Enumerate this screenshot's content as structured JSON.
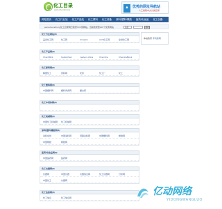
{
  "header": {
    "logo_title": "化工目录",
    "logo_url": "www.chemdir.org",
    "banner_title": "优秀的网址导航站",
    "banner_sub": "人工编辑中文分类目录"
  },
  "nav": {
    "items": [
      "网站首页",
      "化工行业站",
      "化工产品站",
      "化工原料",
      "化工设备",
      "涂料/塑料/橡胶",
      "医药/化妆品",
      "化工仪器"
    ]
  },
  "search": {
    "text": "www.chemdir.org化工目录网已收录XXX家网站，当前收录量100个优秀网站",
    "select_value": "全部",
    "button_label": "搜索"
  },
  "sidebar": {
    "text": "本站收录",
    "link": "手机版网"
  },
  "sections": [
    {
      "title": "化工行业网站(8)",
      "rows": [
        [
          "盖德化工网",
          "化工网",
          "chinaHG",
          "ACS化工网",
          "全球化工网"
        ]
      ]
    },
    {
      "title": "化工产品网(8)",
      "rows": [
        [
          "ChemBlink",
          "GuideChem",
          "made-in-china",
          "Chemrine",
          "ChemicalBook"
        ]
      ]
    },
    {
      "title": "化工原料网(8)",
      "rows": [
        [
          "精细化工",
          "原料网",
          "化原",
          "化工厂",
          "化工"
        ]
      ]
    },
    {
      "title": "化工塑料网(8)",
      "rows": [
        [
          "中国塑料网",
          "塑料商务网",
          "塑交所"
        ]
      ]
    },
    {
      "title": "化工中间体网(8)",
      "rows": [
        []
      ]
    },
    {
      "title": "化工机械网(8)",
      "rows": [
        [
          "中国化工机械网",
          "化工机械网"
        ]
      ]
    },
    {
      "title": "涂料/塑料/橡胶网(8)",
      "rows": [
        [
          "涂料在线",
          "中国涂料网",
          "慧聪涂料网",
          "中国塑料网",
          "橡胶网"
        ],
        [
          "中国橡胶",
          "橡胶网"
        ]
      ]
    },
    {
      "title": "医药/化妆品网(8)",
      "rows": [
        [
          "中国医药网",
          "医药网"
        ]
      ]
    },
    {
      "title": "化工仪器网(8)",
      "rows": [
        [
          "仪器网",
          "中国仪器",
          "仪器信息网",
          "化工仪器网",
          "分析网"
        ],
        [
          "中国化工",
          "仪器网"
        ]
      ]
    },
    {
      "title": "化工信息网(8)",
      "rows": [
        [
          "化工信息",
          "化工信息网"
        ]
      ]
    }
  ],
  "watermark": {
    "text": "亿动网络",
    "sub": "YIDONGWANGLUO"
  }
}
